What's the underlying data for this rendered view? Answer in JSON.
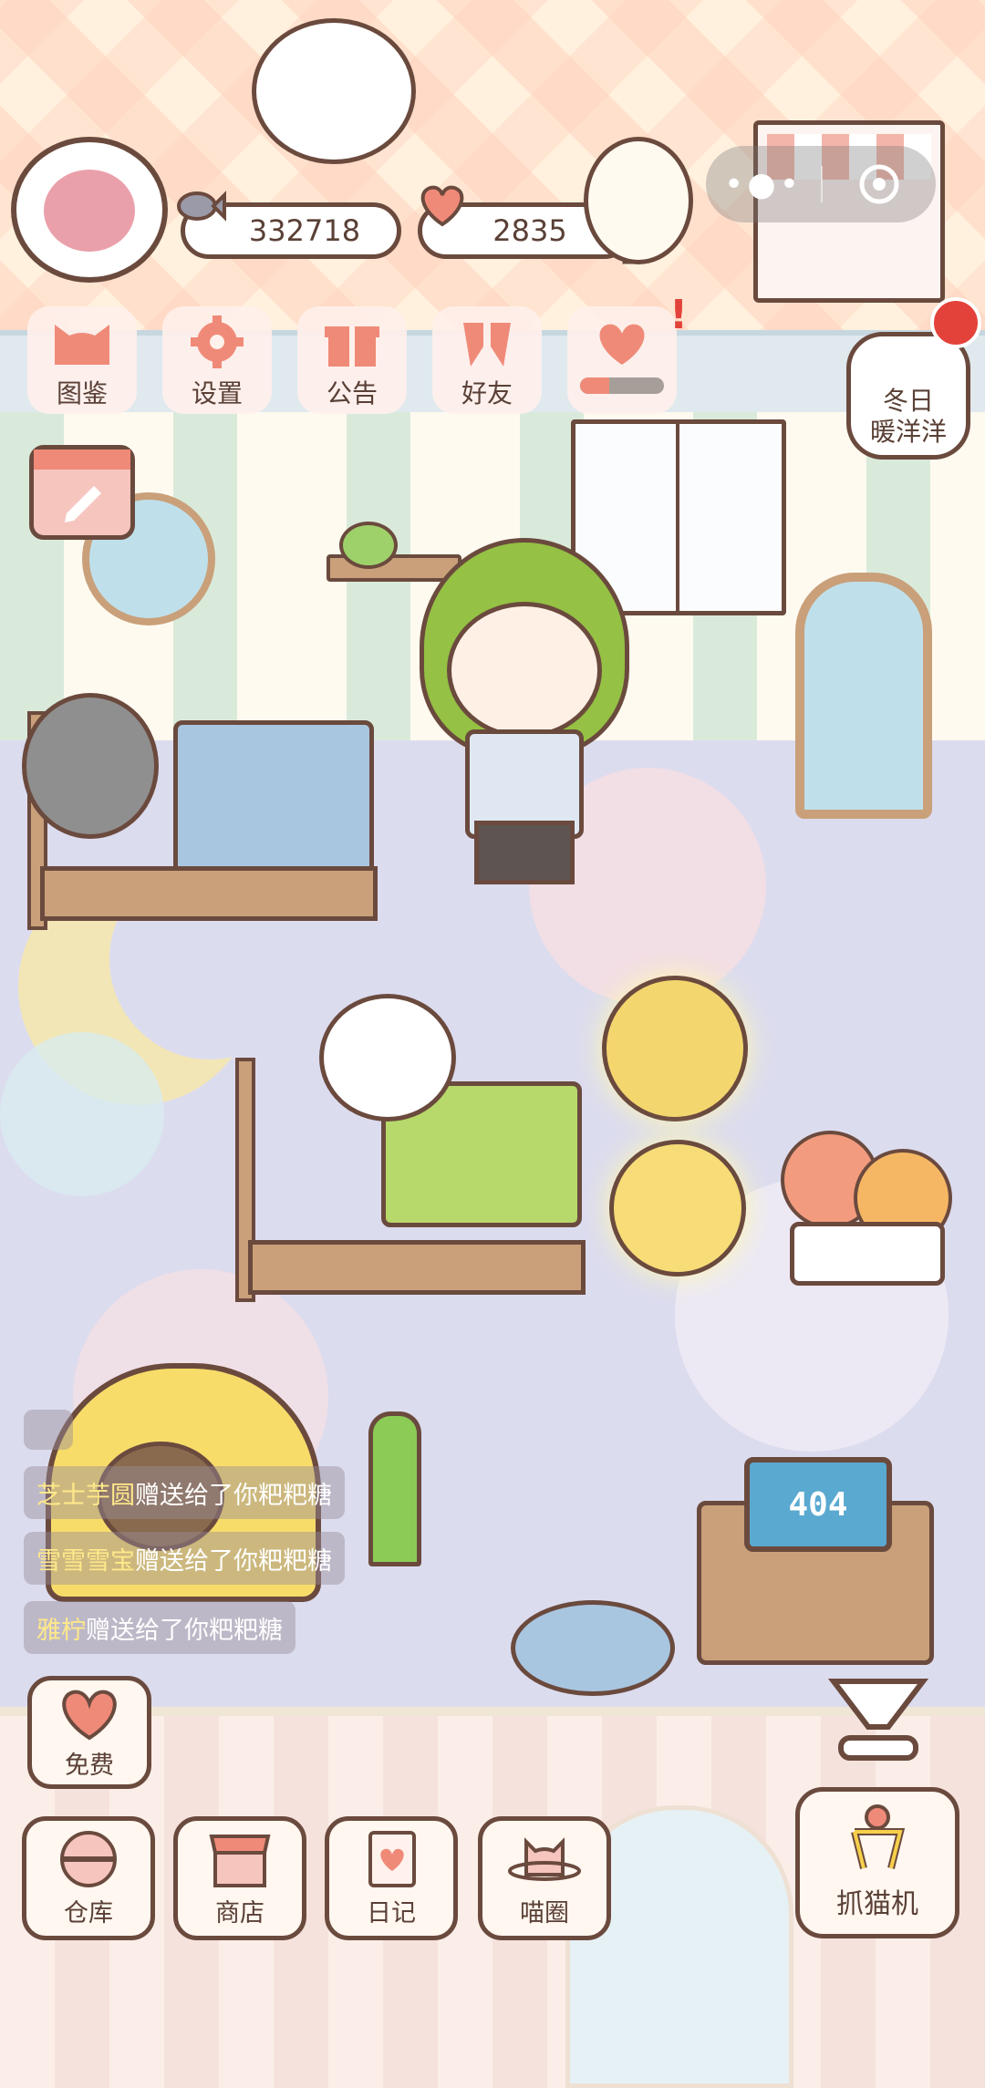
{
  "currency": {
    "fish": "332718",
    "hearts": "2835"
  },
  "top_menu": [
    {
      "label": "图鉴",
      "icon": "cat-head-icon"
    },
    {
      "label": "设置",
      "icon": "gear-icon"
    },
    {
      "label": "公告",
      "icon": "gift-icon"
    },
    {
      "label": "好友",
      "icon": "friends-icon"
    },
    {
      "label": "",
      "icon": "heart-cat-icon",
      "progress": 0.35
    }
  ],
  "event": {
    "line1": "冬日",
    "line2": "暖洋洋"
  },
  "computer_screen": "404",
  "gift_messages": [
    {
      "sender": "芝士芋圆",
      "text": "赠送给了你粑粑糖"
    },
    {
      "sender": "雪雪雪宝",
      "text": "赠送给了你粑粑糖"
    },
    {
      "sender": "雅柠",
      "text": "赠送给了你粑粑糖"
    }
  ],
  "free_button": {
    "label": "免费"
  },
  "bottom_menu": [
    {
      "label": "仓库",
      "icon": "storage-icon"
    },
    {
      "label": "商店",
      "icon": "shop-icon"
    },
    {
      "label": "日记",
      "icon": "diary-icon"
    },
    {
      "label": "喵圈",
      "icon": "planet-cat-icon"
    }
  ],
  "claw_machine": {
    "label": "抓猫机",
    "icon": "claw-icon"
  },
  "colors": {
    "outline": "#6b4a3e",
    "accent": "#f08a78",
    "text": "#5a4036",
    "green_cross": "#a8d84a"
  }
}
